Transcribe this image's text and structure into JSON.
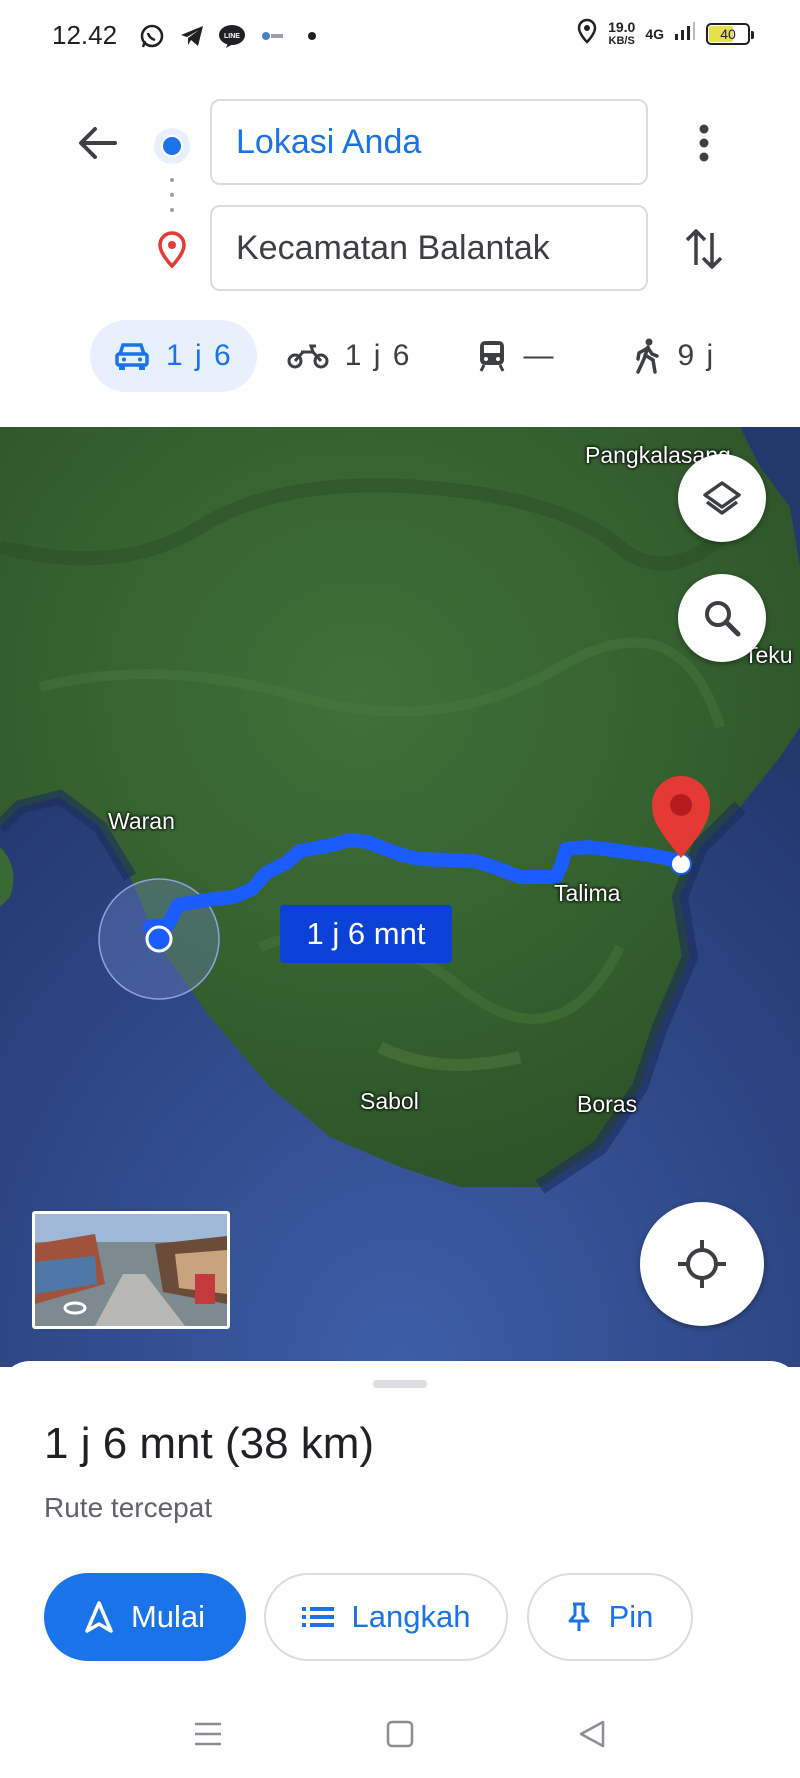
{
  "status_bar": {
    "time": "12.42",
    "speed_value": "19.0",
    "speed_unit": "KB/S",
    "network": "4G",
    "battery": "40"
  },
  "directions": {
    "origin": "Lokasi Anda",
    "destination": "Kecamatan Balantak"
  },
  "modes": [
    {
      "name": "car",
      "label": "1 j 6",
      "active": true
    },
    {
      "name": "motorcycle",
      "label": "1 j 6",
      "active": false
    },
    {
      "name": "transit",
      "label": "—",
      "active": false
    },
    {
      "name": "walk",
      "label": "9 j",
      "active": false
    }
  ],
  "map": {
    "labels": {
      "pangkalasang": "Pangkalasang",
      "teku": "Teku",
      "waran": "Waran",
      "talima": "Talima",
      "sabol": "Sabol",
      "boras": "Boras"
    },
    "route_duration": "1 j 6 mnt",
    "colors": {
      "route": "#1a5cff",
      "pin": "#e53935",
      "land": "#3b6b30",
      "sea": "#2a3f78"
    }
  },
  "sheet": {
    "summary": "1 j 6 mnt (38 km)",
    "subtitle": "Rute tercepat",
    "start_label": "Mulai",
    "steps_label": "Langkah",
    "pin_label": "Pin"
  },
  "colors": {
    "accent": "#1a73e8",
    "accent_light": "#e8f0fe"
  }
}
